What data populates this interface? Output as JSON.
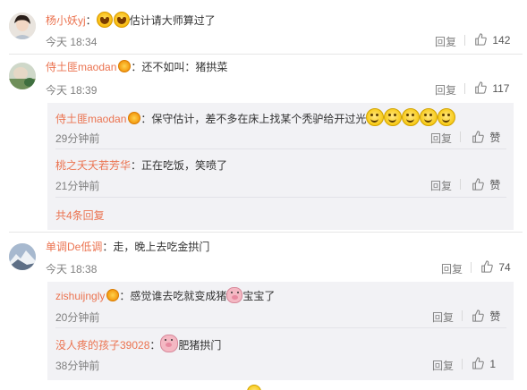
{
  "comments": [
    {
      "user": "杨小妖yj",
      "colon": "：",
      "text": "估计请大师算过了",
      "time": "今天 18:34",
      "reply_label": "回复",
      "likes": "142"
    },
    {
      "user": "侍土匪maodan",
      "colon": "：",
      "text": "还不如叫：猪拱菜",
      "time": "今天 18:39",
      "reply_label": "回复",
      "likes": "117",
      "replies": [
        {
          "user": "侍土匪maodan",
          "colon": "：",
          "text": "保守估计，差不多在床上找某个秃驴给开过光",
          "time": "29分钟前",
          "reply_label": "回复",
          "like_label": "赞"
        },
        {
          "user": "桃之夭夭若芳华",
          "colon": "：",
          "text": "正在吃饭，笑喷了",
          "time": "21分钟前",
          "reply_label": "回复",
          "like_label": "赞"
        }
      ],
      "more_label": "共4条回复"
    },
    {
      "user": "单调De低调",
      "colon": "：",
      "text": "走，晚上去吃金拱门",
      "time": "今天 18:38",
      "reply_label": "回复",
      "likes": "74",
      "replies": [
        {
          "user": "zishuijngly",
          "colon": "：",
          "text_before": "感觉谁去吃就变成猪",
          "text_after": "宝宝了",
          "time": "20分钟前",
          "reply_label": "回复",
          "like_label": "赞"
        },
        {
          "user": "没人疼的孩子39028",
          "colon": "：",
          "text": "肥猪拱门",
          "time": "38分钟前",
          "reply_label": "回复",
          "likes": "1"
        }
      ]
    }
  ],
  "colors": {
    "username": "#eb7350",
    "meta": "#808080",
    "reply_bg": "#f2f2f5"
  }
}
